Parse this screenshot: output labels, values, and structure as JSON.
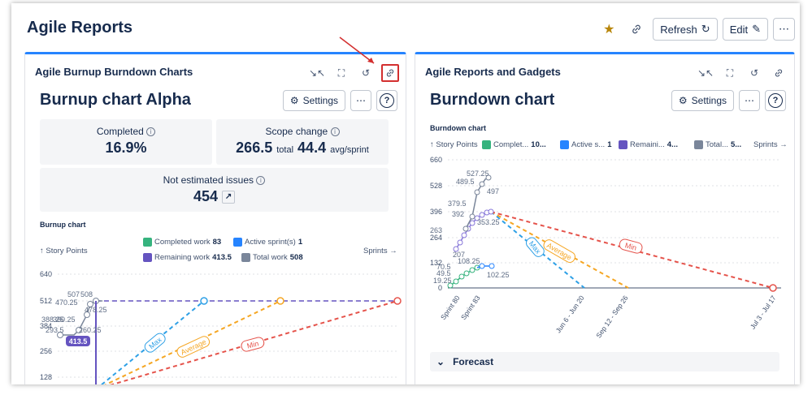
{
  "page": {
    "title": "Agile Reports",
    "refresh_label": "Refresh",
    "edit_label": "Edit",
    "more_label": "⋯"
  },
  "left_panel": {
    "title": "Agile Burnup Burndown Charts",
    "chart_title": "Burnup chart Alpha",
    "settings_label": "Settings",
    "more_label": "⋯",
    "help_label": "?",
    "stats": {
      "completed_label": "Completed",
      "completed_value": "16.9%",
      "scope_label": "Scope change",
      "scope_total": "266.5",
      "scope_total_unit": "total",
      "scope_avg": "44.4",
      "scope_avg_unit": "avg/sprint",
      "not_estimated_label": "Not estimated issues",
      "not_estimated_value": "454"
    },
    "chart_label": "Burnup chart",
    "y_axis_note": "↑ Story Points",
    "x_axis_note": "Sprints →",
    "legend": [
      {
        "label": "Completed work",
        "value": "83",
        "color": "#36b37e"
      },
      {
        "label": "Active sprint(s)",
        "value": "1",
        "color": "#2684ff"
      },
      {
        "label": "Remaining work",
        "value": "413.5",
        "color": "#6554c0"
      },
      {
        "label": "Total work",
        "value": "508",
        "color": "#7a869a"
      }
    ],
    "y_ticks": [
      "640",
      "512",
      "384",
      "256",
      "128"
    ],
    "forecast_labels": [
      "Max",
      "Average",
      "Min"
    ],
    "point_labels": [
      "507",
      "508",
      "470.25",
      "478.25",
      "388.25",
      "293.5",
      "360.25",
      "260.25",
      "413.5"
    ]
  },
  "right_panel": {
    "title": "Agile Reports and Gadgets",
    "chart_title": "Burndown chart",
    "settings_label": "Settings",
    "more_label": "⋯",
    "help_label": "?",
    "chart_label": "Burndown chart",
    "y_axis_note": "↑ Story Points",
    "x_axis_note": "Sprints →",
    "legend": [
      {
        "label": "Complet...",
        "value": "10...",
        "color": "#36b37e"
      },
      {
        "label": "Active s...",
        "value": "1",
        "color": "#2684ff"
      },
      {
        "label": "Remaini...",
        "value": "4...",
        "color": "#6554c0"
      },
      {
        "label": "Total...",
        "value": "5...",
        "color": "#7a869a"
      }
    ],
    "y_ticks": [
      "660",
      "528",
      "396",
      "264",
      "132",
      "0"
    ],
    "x_ticks": [
      "Sprint 80",
      "Sprint 83",
      "Jun 6 - Jun 20",
      "Sep 12 - Sep 26",
      "Jul 3 - Jul 17"
    ],
    "forecast_labels": [
      "Max",
      "Average",
      "Min"
    ],
    "point_labels": [
      "527.25",
      "489.5",
      "497",
      "379.5",
      "392",
      "353.25",
      "263",
      "207",
      "108.25",
      "102.25",
      "70.5",
      "49.5",
      "19.25"
    ],
    "forecast_section": "Forecast"
  }
}
